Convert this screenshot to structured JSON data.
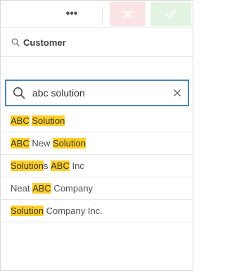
{
  "toolbar": {
    "more_label": "•••",
    "cancel_icon": "close-icon",
    "confirm_icon": "checkmark-icon",
    "cancel_color": "#fbe4e4",
    "confirm_color": "#e3f4e3"
  },
  "header": {
    "title": "Customer",
    "icon": "search-icon"
  },
  "search": {
    "value": "abc solution",
    "clear_icon": "close-icon",
    "border_color": "#4a86b8"
  },
  "highlight_color": "#ffcf27",
  "results": [
    [
      {
        "t": "ABC",
        "h": true
      },
      {
        "t": " ",
        "h": false
      },
      {
        "t": "Solution",
        "h": true
      }
    ],
    [
      {
        "t": "ABC",
        "h": true
      },
      {
        "t": " New ",
        "h": false
      },
      {
        "t": "Solution",
        "h": true
      }
    ],
    [
      {
        "t": "Solution",
        "h": true
      },
      {
        "t": "s ",
        "h": false
      },
      {
        "t": "ABC",
        "h": true
      },
      {
        "t": " Inc",
        "h": false
      }
    ],
    [
      {
        "t": "Neat ",
        "h": false
      },
      {
        "t": "ABC",
        "h": true
      },
      {
        "t": " Company",
        "h": false
      }
    ],
    [
      {
        "t": "Solution",
        "h": true
      },
      {
        "t": " Company Inc.",
        "h": false
      }
    ]
  ]
}
